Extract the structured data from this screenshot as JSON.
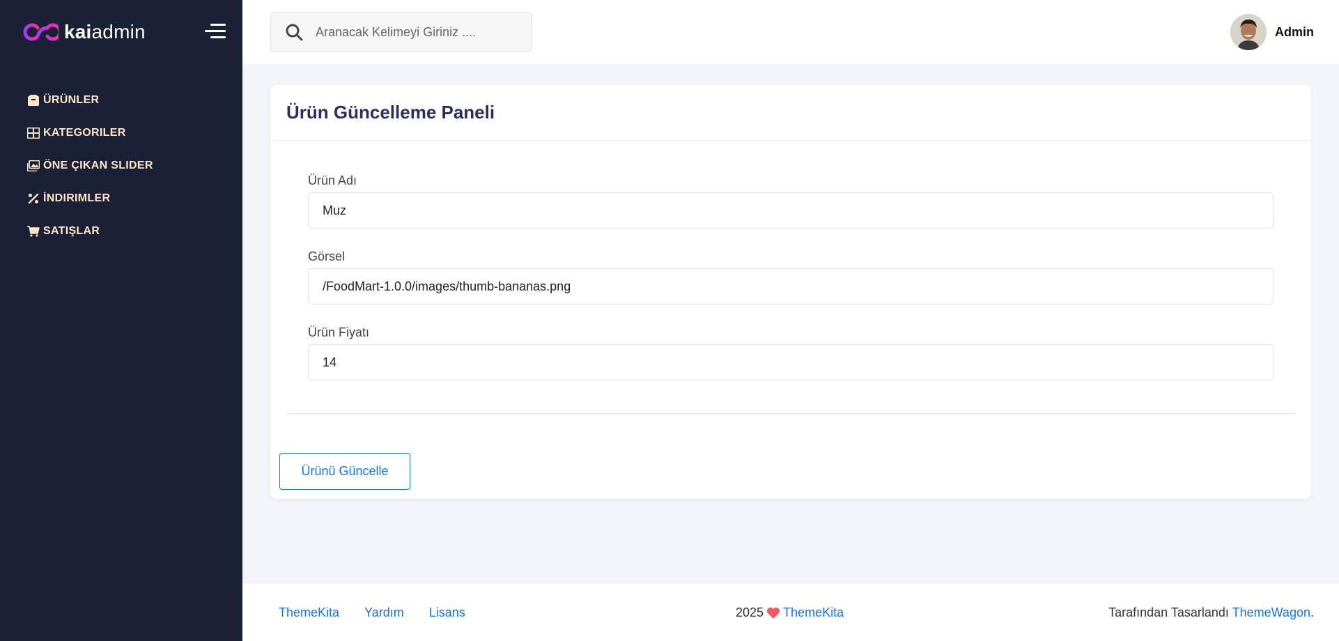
{
  "sidebar": {
    "logo": {
      "bold": "kai",
      "thin": "admin"
    },
    "items": [
      {
        "label": "ÜRÜNLER",
        "icon": "box-icon"
      },
      {
        "label": "KATEGORILER",
        "icon": "grid-icon"
      },
      {
        "label": "ÖNE ÇIKAN SLIDER",
        "icon": "images-icon"
      },
      {
        "label": "İNDIRIMLER",
        "icon": "percent-icon"
      },
      {
        "label": "SATIŞLAR",
        "icon": "cart-icon"
      }
    ]
  },
  "header": {
    "search_placeholder": "Aranacak Kelimeyi Giriniz ....",
    "user_name": "Admin"
  },
  "card": {
    "title": "Ürün Güncelleme Paneli",
    "fields": [
      {
        "label": "Ürün Adı",
        "value": "Muz"
      },
      {
        "label": "Görsel",
        "value": "/FoodMart-1.0.0/images/thumb-bananas.png"
      },
      {
        "label": "Ürün Fiyatı",
        "value": "14"
      }
    ],
    "submit_label": "Ürünü Güncelle"
  },
  "footer": {
    "links": [
      "ThemeKita",
      "Yardım",
      "Lisans"
    ],
    "year": "2025",
    "brand": "ThemeKita",
    "credit_text": "Tarafından Tasarlandı",
    "credit_link": "ThemeWagon",
    "credit_suffix": "."
  },
  "colors": {
    "sidebar_bg": "#1a2035",
    "accent": "#1572e8",
    "nav_text": "#fde5c8",
    "logo_gradient": [
      "#6861ce",
      "#ff0084"
    ],
    "heart": "#f25961"
  }
}
